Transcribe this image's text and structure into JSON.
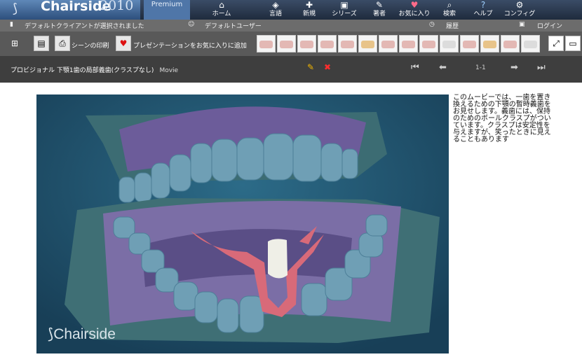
{
  "app": {
    "brand": "Chairside",
    "year": "2010",
    "edition": "Premium"
  },
  "nav": [
    {
      "label": "ホーム",
      "icon": "home-icon"
    },
    {
      "label": "言語",
      "icon": "language-icon"
    },
    {
      "label": "新規",
      "icon": "new-icon"
    },
    {
      "label": "シリーズ",
      "icon": "series-icon"
    },
    {
      "label": "著者",
      "icon": "author-icon"
    },
    {
      "label": "お気に入り",
      "icon": "favorites-icon"
    },
    {
      "label": "検索",
      "icon": "search-icon"
    },
    {
      "label": "ヘルプ",
      "icon": "help-icon"
    },
    {
      "label": "コンフィグ",
      "icon": "config-icon"
    }
  ],
  "status": {
    "client": "デフォルトクライアントが選択されました",
    "user": "デフォルトユーザー",
    "history": "履歴",
    "login": "ログイン"
  },
  "toolbar": {
    "print_scene": "シーンの印刷",
    "add_favorite": "プレゼンテーションをお気に入りに追加"
  },
  "presentation": {
    "title": "プロビジョナル 下顎1歯の局部義歯(クラスプなし)",
    "type": "Movie",
    "page": "1-1",
    "description": "このムービーでは、一歯を置き換えるための下顎の暫時義歯をお見せします。義歯には、保持のためのボールクラスプがついています。クラスプは安定性を与えますが、笑ったときに見えることもあります",
    "watermark": "Chairside"
  },
  "colors": {
    "video_bg": "#20556e",
    "tooth": "#6f9fb5",
    "gum": "#7b7aa8",
    "denture_base": "#d86a79",
    "crown": "#efefe7"
  }
}
